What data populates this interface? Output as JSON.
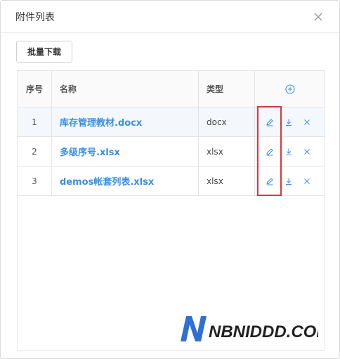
{
  "dialog": {
    "title": "附件列表",
    "close_label": "×"
  },
  "toolbar": {
    "batch_download_label": "批量下载"
  },
  "table": {
    "headers": {
      "index": "序号",
      "name": "名称",
      "type": "类型"
    },
    "rows": [
      {
        "index": "1",
        "name": "库存管理教材.docx",
        "type": "docx"
      },
      {
        "index": "2",
        "name": "多级序号.xlsx",
        "type": "xlsx"
      },
      {
        "index": "3",
        "name": "demos帐套列表.xlsx",
        "type": "xlsx"
      }
    ],
    "icons": {
      "add": "plus-circle-icon",
      "edit": "pencil-icon",
      "download": "download-icon",
      "delete": "close-icon"
    }
  },
  "watermark": {
    "text": "NBNIDDD.COM"
  },
  "colors": {
    "accent": "#3a8ee6",
    "highlight": "#d9363e",
    "border": "#e4e4e4",
    "icon": "#3a8ee6"
  }
}
